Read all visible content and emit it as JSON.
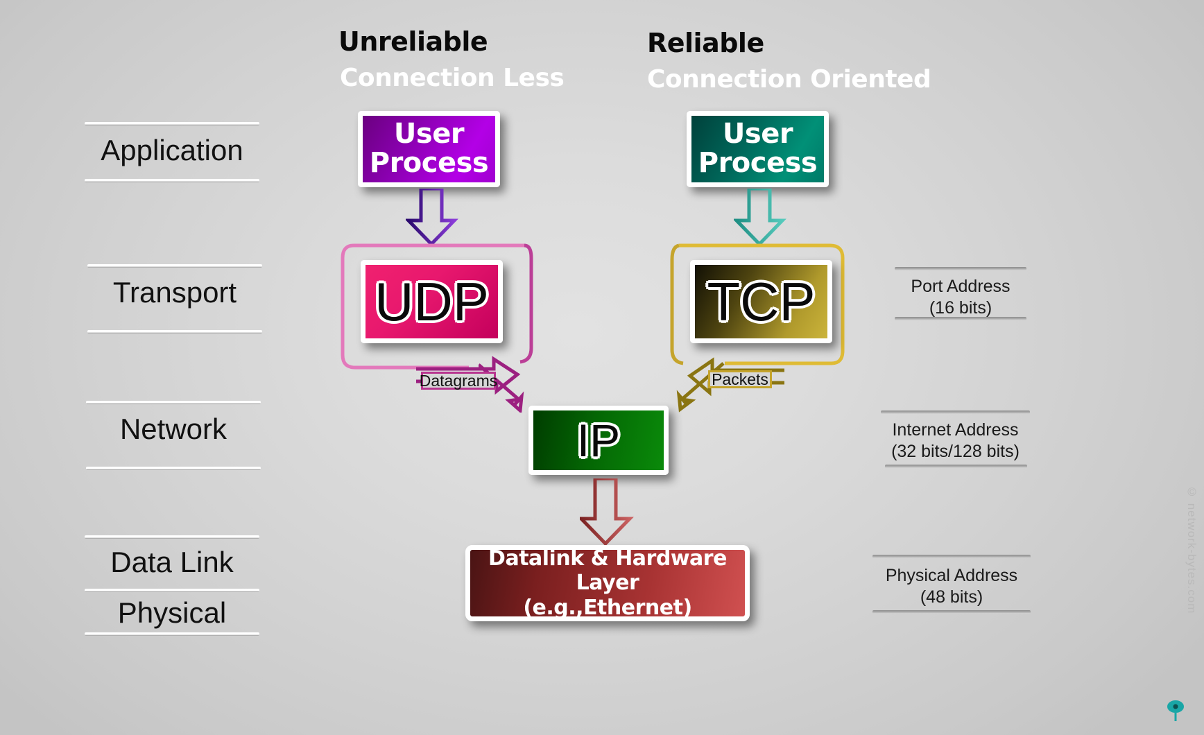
{
  "headers": {
    "left_top": "Unreliable",
    "left_sub": "Connection Less",
    "right_top": "Reliable",
    "right_sub": "Connection Oriented"
  },
  "layers": [
    {
      "name": "Application"
    },
    {
      "name": "Transport"
    },
    {
      "name": "Network"
    },
    {
      "name": "Data Link"
    },
    {
      "name": "Physical"
    }
  ],
  "boxes": {
    "user_process_left": {
      "line1": "User",
      "line2": "Process",
      "color": "#9900cc"
    },
    "user_process_right": {
      "line1": "User",
      "line2": "Process",
      "color": "#006655"
    },
    "udp": {
      "label": "UDP",
      "color": "#e8186e"
    },
    "tcp": {
      "label": "TCP",
      "color": "#b5992a"
    },
    "ip": {
      "label": "IP",
      "color": "#0a7a0a"
    },
    "datalink": {
      "line1": "Datalink & Hardware Layer",
      "line2": "(e.g.,Ethernet)",
      "color": "#b33030"
    }
  },
  "pdu_labels": {
    "datagrams": "Datagrams",
    "packets": "Packets"
  },
  "annotations": [
    {
      "line1": "Port Address",
      "line2": "(16 bits)"
    },
    {
      "line1": "Internet Address",
      "line2": "(32 bits/128 bits)"
    },
    {
      "line1": "Physical Address",
      "line2": "(48 bits)"
    }
  ],
  "watermark": {
    "text": "© network-bytes.com"
  },
  "accents": {
    "arrow_purple": "#3d0a8c",
    "arrow_teal": "#2aa79b",
    "udp_outline": "#e07ab8",
    "tcp_outline": "#d6b33a",
    "datagram_arrow": "#9c2080",
    "packet_arrow": "#8a7512",
    "ip_arrow": "#9c3b3b"
  }
}
